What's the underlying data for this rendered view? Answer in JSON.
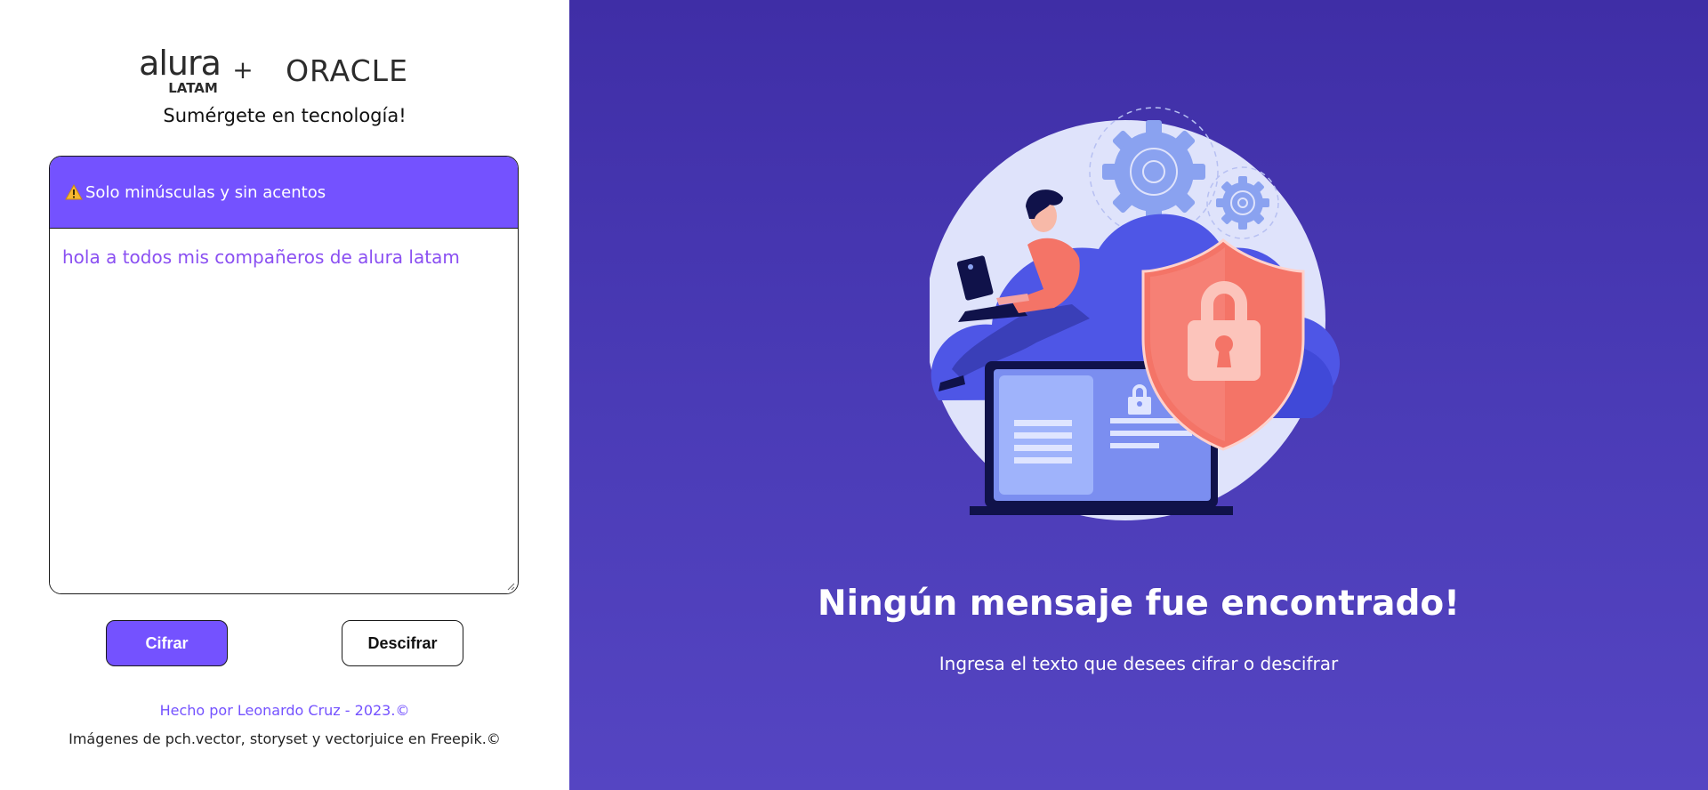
{
  "brand": {
    "logo_alura_main": "alura",
    "logo_alura_sub": "LATAM",
    "logo_plus": "+",
    "logo_oracle": "ORACLE"
  },
  "tagline": "Sumérgete en tecnología!",
  "editor": {
    "warning_label": "Solo minúsculas y sin acentos",
    "text_value": "hola a todos mis compañeros de alura latam"
  },
  "buttons": {
    "encrypt_label": "Cifrar",
    "decrypt_label": "Descifrar"
  },
  "footer": {
    "credit": "Hecho por Leonardo Cruz - 2023.©",
    "images_credit": "Imágenes de pch.vector, storyset y vectorjuice en Freepik.©"
  },
  "result": {
    "title": "Ningún mensaje fue encontrado!",
    "subtitle": "Ingresa el texto que desees cifrar o descifrar"
  },
  "colors": {
    "accent": "#7452ff",
    "text_purple": "#8a4ff2",
    "right_panel_top": "#3f2ea6",
    "right_panel_bottom": "#5545c2",
    "shield": "#f47467"
  },
  "icons": {
    "warning": "warning-icon",
    "illustration": "security-illustration"
  }
}
